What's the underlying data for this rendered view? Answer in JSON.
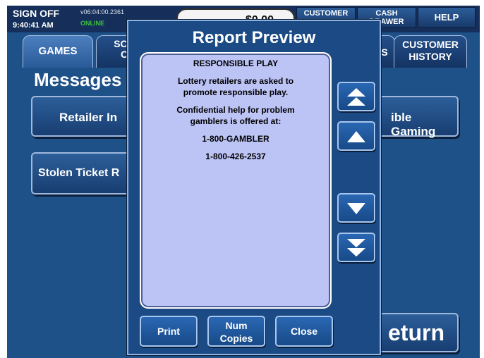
{
  "topbar": {
    "sign_off": "SIGN OFF",
    "time": "9:40:41 AM",
    "version": "v06:04:00.2361",
    "status": "ONLINE",
    "amount": "$0.00",
    "customer": "CUSTOMER",
    "cash_drawer": "CASH\nDRAWER",
    "help": "HELP"
  },
  "tabs": {
    "games": "GAMES",
    "scratch": "SCR\nC",
    "hidden_partial": "S",
    "customer_history": "CUSTOMER\nHISTORY"
  },
  "background": {
    "messages_title": "Messages",
    "retailer_button": "Retailer In",
    "stolen_button": "Stolen Ticket R",
    "gaming_button": "ible Gaming",
    "return_button": "eturn"
  },
  "dialog": {
    "title": "Report Preview",
    "report": {
      "heading": "RESPONSIBLE PLAY",
      "line1": "Lottery retailers are asked to",
      "line2": "promote responsible play.",
      "line3": "Confidential help for problem",
      "line4": "gamblers is offered at:",
      "phone1": "1-800-GAMBLER",
      "phone2": "1-800-426-2537"
    },
    "buttons": {
      "print": "Print",
      "num_copies": "Num\nCopies",
      "close": "Close"
    },
    "scroll_icons": [
      "scroll-to-top-icon",
      "scroll-up-icon",
      "scroll-down-icon",
      "scroll-to-bottom-icon"
    ]
  },
  "colors": {
    "background_blue": "#1f5189",
    "dialog_blue": "#1b4a84",
    "report_lavender": "#bcc3f5",
    "online_green": "#3ec23e"
  }
}
